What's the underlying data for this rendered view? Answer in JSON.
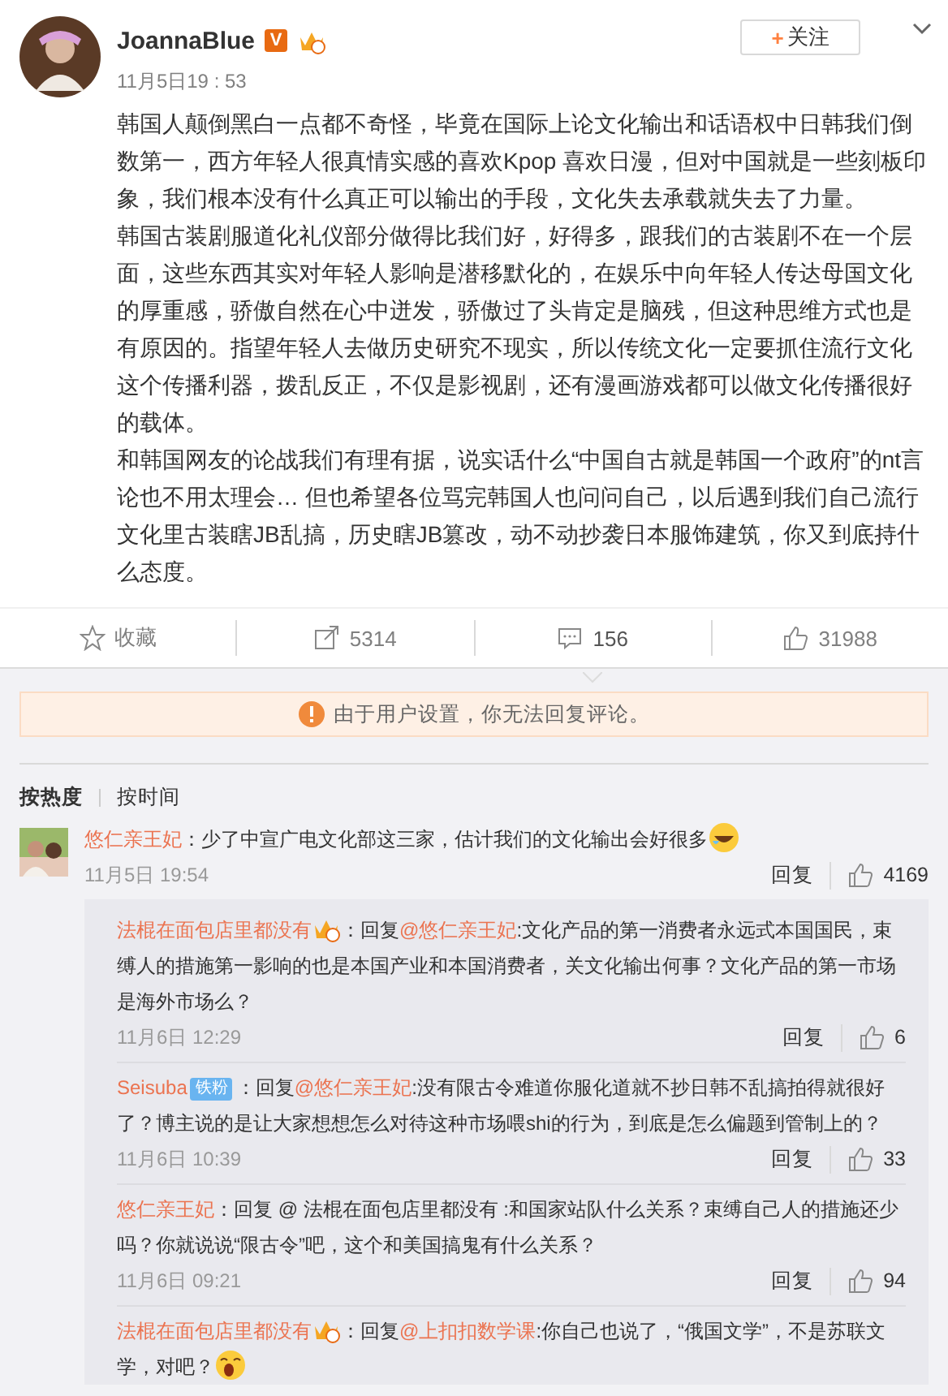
{
  "post": {
    "user": "JoannaBlue",
    "verified_mark": "V",
    "follow": {
      "plus": "+",
      "label": "关注"
    },
    "time": "11月5日19 : 53",
    "paragraphs": [
      "韩国人颠倒黑白一点都不奇怪，毕竟在国际上论文化输出和话语权中日韩我们倒数第一，西方年轻人很真情实感的喜欢Kpop 喜欢日漫，但对中国就是一些刻板印象，我们根本没有什么真正可以输出的手段，文化失去承载就失去了力量。",
      "韩国古装剧服道化礼仪部分做得比我们好，好得多，跟我们的古装剧不在一个层面，这些东西其实对年轻人影响是潜移默化的，在娱乐中向年轻人传达母国文化的厚重感，骄傲自然在心中迸发，骄傲过了头肯定是脑残，但这种思维方式也是有原因的。指望年轻人去做历史研究不现实，所以传统文化一定要抓住流行文化这个传播利器，拨乱反正，不仅是影视剧，还有漫画游戏都可以做文化传播很好的载体。",
      "和韩国网友的论战我们有理有据，说实话什么“中国自古就是韩国一个政府”的nt言论也不用太理会… 但也希望各位骂完韩国人也问问自己，以后遇到我们自己流行文化里古装瞎JB乱搞，历史瞎JB篡改，动不动抄袭日本服饰建筑，你又到底持什么态度。"
    ]
  },
  "actions": [
    {
      "kind": "favorite",
      "label": "收藏",
      "selected": false
    },
    {
      "kind": "repost",
      "label": "5314",
      "selected": false
    },
    {
      "kind": "comment",
      "label": "156",
      "selected": true
    },
    {
      "kind": "like",
      "label": "31988",
      "selected": false
    }
  ],
  "notice": "由于用户设置，你无法回复评论。",
  "sort_tabs": [
    {
      "label": "按热度",
      "selected": true
    },
    {
      "label": "按时间",
      "selected": false
    }
  ],
  "comments": [
    {
      "user": "悠仁亲王妃",
      "body": [
        {
          "kind": "text",
          "text": "：少了中宣广电文化部这三家，估计我们的文化输出会好很多"
        },
        {
          "kind": "laughing-emoji"
        }
      ],
      "time": "11月5日 19:54",
      "reply": "回复",
      "likes": "4169",
      "replies": [
        {
          "user": "法棍在面包店里都没有",
          "badge": {
            "kind": "crown"
          },
          "body": [
            {
              "kind": "text",
              "text": "：回复"
            },
            {
              "kind": "mention",
              "text": "@悠仁亲王妃"
            },
            {
              "kind": "text",
              "text": ":文化产品的第一消费者永远式本国国民，束缚人的措施第一影响的也是本国产业和本国消费者，关文化输出何事？文化产品的第一市场是海外市场么？"
            }
          ],
          "time": "11月6日 12:29",
          "reply": "回复",
          "likes": "6"
        },
        {
          "user": "Seisuba",
          "badge": {
            "kind": "label",
            "text": "铁粉"
          },
          "body": [
            {
              "kind": "text",
              "text": "：回复"
            },
            {
              "kind": "mention",
              "text": "@悠仁亲王妃"
            },
            {
              "kind": "text",
              "text": ":没有限古令难道你服化道就不抄日韩不乱搞拍得就很好了？博主说的是让大家想想怎么对待这种市场喂shi的行为，到底是怎么偏题到管制上的？"
            }
          ],
          "time": "11月6日 10:39",
          "reply": "回复",
          "likes": "33"
        },
        {
          "user": "悠仁亲王妃",
          "body": [
            {
              "kind": "text",
              "text": "：回复 @ 法棍在面包店里都没有 :和国家站队什么关系？束缚自己人的措施还少吗？你就说说“限古令”吧，这个和美国搞鬼有什么关系？"
            }
          ],
          "time": "11月6日 09:21",
          "reply": "回复",
          "likes": "94"
        },
        {
          "user": "法棍在面包店里都没有",
          "badge": {
            "kind": "crown"
          },
          "body": [
            {
              "kind": "text",
              "text": "：回复"
            },
            {
              "kind": "mention",
              "text": "@上扣扣数学课"
            },
            {
              "kind": "text",
              "text": ":你自己也说了，“俄国文学”，不是苏联文学，对吧？"
            },
            {
              "kind": "yawning-emoji"
            }
          ]
        }
      ]
    }
  ]
}
